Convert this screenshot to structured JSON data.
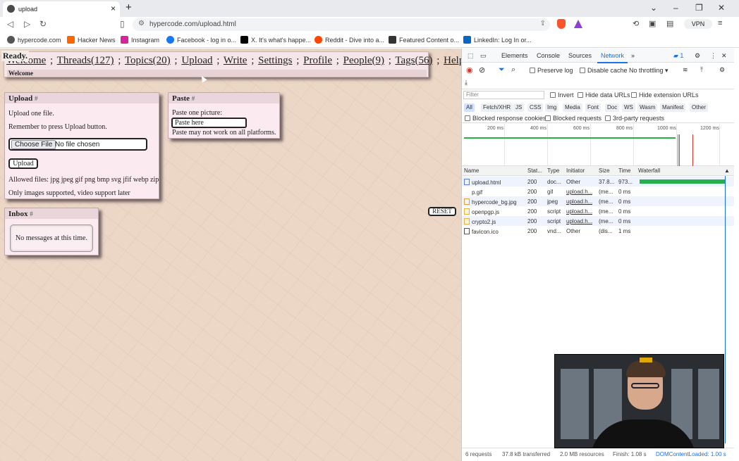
{
  "browser": {
    "tab_title": "upload",
    "tab_close": "×",
    "new_tab": "+",
    "url": "hypercode.com/upload.html",
    "vpn_label": "VPN",
    "bookmarks": [
      {
        "label": "hypercode.com",
        "icon": "globe-icon",
        "color": "#555555"
      },
      {
        "label": "Hacker News",
        "icon": "y-icon",
        "color": "#ff6600"
      },
      {
        "label": "Instagram",
        "icon": "instagram-icon",
        "color": "#d6249f"
      },
      {
        "label": "Facebook - log in o...",
        "icon": "facebook-icon",
        "color": "#1877f2"
      },
      {
        "label": "X. It's what's happe...",
        "icon": "x-icon",
        "color": "#000000"
      },
      {
        "label": "Reddit - Dive into a...",
        "icon": "reddit-icon",
        "color": "#ff4500"
      },
      {
        "label": "Featured Content o...",
        "icon": "featured-icon",
        "color": "#333333"
      },
      {
        "label": "LinkedIn: Log In or...",
        "icon": "linkedin-icon",
        "color": "#0a66c2"
      }
    ]
  },
  "page": {
    "status": "Ready.",
    "menu": {
      "welcome": "Welcome",
      "threads": "Threads(127)",
      "topics": "Topics(20)",
      "upload": "Upload",
      "write": "Write",
      "settings": "Settings",
      "profile": "Profile",
      "people": "People(9)",
      "tags": "Tags(56)",
      "help": "Help",
      "sep": ";"
    },
    "menu_sub": "Welcome",
    "upload_panel": {
      "title": "Upload",
      "hash": "#",
      "line1": "Upload one file.",
      "line2": "Remember to press Upload button.",
      "choose_label": "Choose File",
      "no_file": "No file chosen",
      "upload_button": "Upload",
      "allowed": "Allowed files: jpg jpeg gif png bmp svg jfif webp zip",
      "note": "Only images supported, video support later"
    },
    "paste_panel": {
      "title": "Paste",
      "hash": "#",
      "line1": "Paste one picture:",
      "placeholder": "Paste here",
      "note": "Paste may not work on all platforms."
    },
    "inbox_panel": {
      "title": "Inbox",
      "hash": "#",
      "empty": "No messages at this time."
    },
    "reset_label": "RESET"
  },
  "devtools": {
    "tabs": [
      "Elements",
      "Console",
      "Sources",
      "Network"
    ],
    "more": "»",
    "issues_badge": "1",
    "preserve_log": "Preserve log",
    "disable_cache": "Disable cache",
    "throttling": "No throttling",
    "filter_placeholder": "Filter",
    "invert": "Invert",
    "hide_data_urls": "Hide data URLs",
    "hide_ext_urls": "Hide extension URLs",
    "type_filters": [
      "All",
      "Fetch/XHR",
      "JS",
      "CSS",
      "Img",
      "Media",
      "Font",
      "Doc",
      "WS",
      "Wasm",
      "Manifest",
      "Other"
    ],
    "blocked_cookies": "Blocked response cookies",
    "blocked_requests": "Blocked requests",
    "third_party": "3rd-party requests",
    "ticks": [
      "200 ms",
      "400 ms",
      "600 ms",
      "800 ms",
      "1000 ms",
      "1200 ms"
    ],
    "columns": [
      "Name",
      "Stat...",
      "Type",
      "Initiator",
      "Size",
      "Time",
      "Waterfall"
    ],
    "rows": [
      {
        "name": "upload.html",
        "status": "200",
        "type": "doc...",
        "initiator": "Other",
        "size": "37.8...",
        "time": "973..."
      },
      {
        "name": "p.gif",
        "status": "200",
        "type": "gif",
        "initiator": "upload.h...",
        "size": "(me...",
        "time": "0 ms"
      },
      {
        "name": "hypercode_bg.jpg",
        "status": "200",
        "type": "jpeg",
        "initiator": "upload.h...",
        "size": "(me...",
        "time": "0 ms"
      },
      {
        "name": "openpgp.js",
        "status": "200",
        "type": "script",
        "initiator": "upload.h...",
        "size": "(me...",
        "time": "0 ms"
      },
      {
        "name": "crypto2.js",
        "status": "200",
        "type": "script",
        "initiator": "upload.h...",
        "size": "(me...",
        "time": "0 ms"
      },
      {
        "name": "favicon.ico",
        "status": "200",
        "type": "vnd...",
        "initiator": "Other",
        "size": "(dis...",
        "time": "1 ms"
      }
    ],
    "status": {
      "requests": "6 requests",
      "transferred": "37.8 kB transferred",
      "resources": "2.0 MB resources",
      "finish": "Finish: 1.08 s",
      "dcl": "DOMContentLoaded: 1.00 s"
    }
  }
}
